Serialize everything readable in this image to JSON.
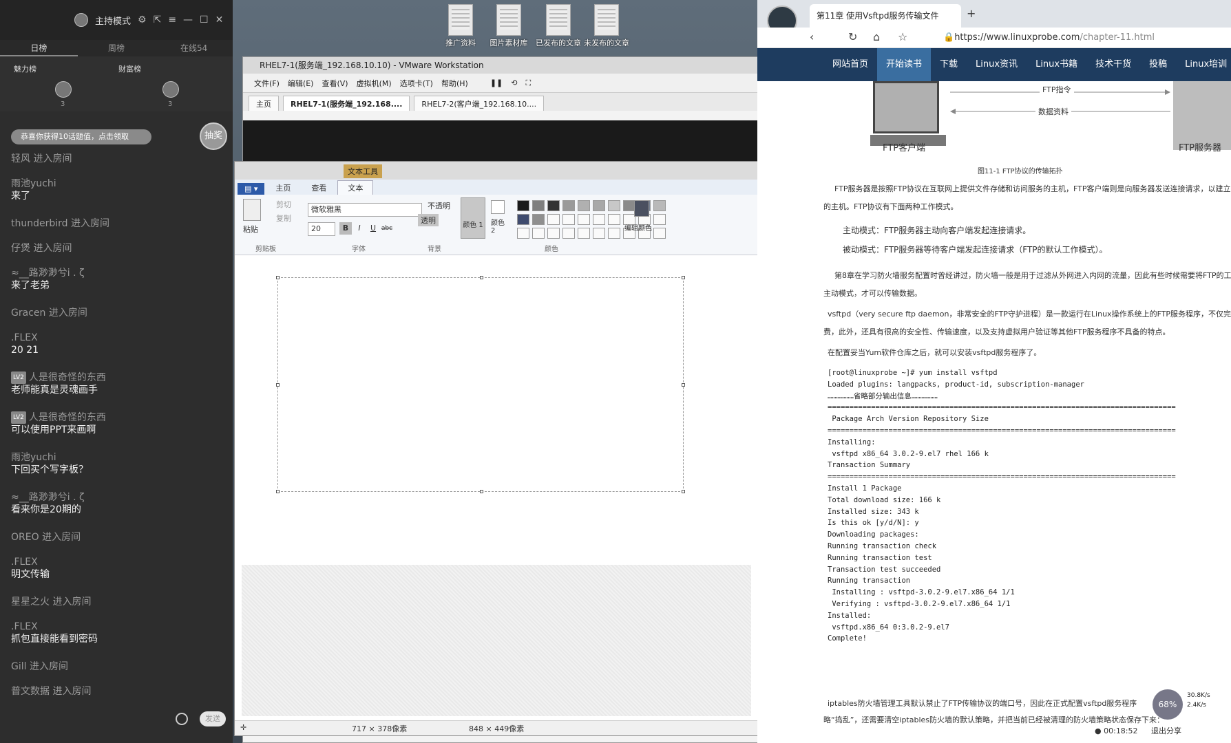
{
  "desktop": {
    "icons": [
      "推广资料",
      "图片素材库",
      "已发布的文章",
      "未发布的文章"
    ]
  },
  "chat": {
    "top_mode": "主持模式",
    "tabs": [
      "日榜",
      "周榜",
      "在线54"
    ],
    "rank_labels": [
      "魅力榜",
      "财富榜"
    ],
    "rank_counts": [
      "3",
      "3"
    ],
    "gift_banner": "恭喜你获得10话题值，点击领取",
    "host_badge": "抽奖",
    "messages": [
      {
        "user": "轻风",
        "text": "进入房间",
        "type": "enter"
      },
      {
        "user": "雨池yuchi",
        "text": "来了",
        "type": "msg"
      },
      {
        "user": "thunderbird",
        "text": "进入房间",
        "type": "enter"
      },
      {
        "user": "仔煲",
        "text": "进入房间",
        "type": "enter"
      },
      {
        "user": "≈__路渺渺兮i . ζ",
        "text": "来了老弟",
        "type": "msg"
      },
      {
        "user": "Gracen",
        "text": "进入房间",
        "type": "enter"
      },
      {
        "user": ".FLEX",
        "text": "20 21",
        "type": "msg"
      },
      {
        "user": "人是很奇怪的东西",
        "text": "老师能真是灵魂画手",
        "type": "msg",
        "lv": "LV2"
      },
      {
        "user": "人是很奇怪的东西",
        "text": "可以使用PPT来画啊",
        "type": "msg",
        "lv": "LV2"
      },
      {
        "user": "雨池yuchi",
        "text": "下回买个写字板？",
        "type": "msg"
      },
      {
        "user": "≈__路渺渺兮i . ζ",
        "text": "看来你是20期的",
        "type": "msg"
      },
      {
        "user": "OREO",
        "text": "进入房间",
        "type": "enter"
      },
      {
        "user": ".FLEX",
        "text": "明文传输",
        "type": "msg"
      },
      {
        "user": "星星之火",
        "text": "进入房间",
        "type": "enter"
      },
      {
        "user": ".FLEX",
        "text": "抓包直接能看到密码",
        "type": "msg"
      },
      {
        "user": "Gill",
        "text": "进入房间",
        "type": "enter"
      },
      {
        "user": "普文数据",
        "text": "进入房间",
        "type": "enter"
      }
    ],
    "send_label": "发送"
  },
  "vmware": {
    "title": "RHEL7-1(服务端_192.168.10.10) - VMware Workstation",
    "menu": [
      "文件(F)",
      "编辑(E)",
      "查看(V)",
      "虚拟机(M)",
      "选项卡(T)",
      "帮助(H)"
    ],
    "tabs": [
      "主页",
      "RHEL7-1(服务端_192.168....",
      "RHEL7-2(客户端_192.168.10...."
    ]
  },
  "paint": {
    "tool_tag": "文本工具",
    "tabs": [
      "主页",
      "查看",
      "文本"
    ],
    "paste": "粘贴",
    "cut": "剪切",
    "copy": "复制",
    "font_name": "微软雅黑",
    "font_size": "20",
    "opaque": "不透明",
    "transparent": "透明",
    "color1": "颜色 1",
    "color2": "颜色 2",
    "edit_colors": "编辑颜色",
    "group_labels": [
      "剪贴板",
      "字体",
      "背景",
      "颜色"
    ],
    "status_selection": "717 × 378像素",
    "status_size": "848 × 449像素",
    "palette": [
      "#1a1a1a",
      "#7f7f7f",
      "#333333",
      "#9a9a9a",
      "#b0b0b0",
      "#a8a8a8",
      "#c8c8c8",
      "#8a8a8a",
      "#6e7a8e",
      "#b9b9b9",
      "#3f4b6e",
      "#8f8f8f"
    ]
  },
  "browser": {
    "tab_title": "第11章 使用Vsftpd服务传输文件",
    "url_domain": "https://www.linuxprobe.com",
    "url_path": "/chapter-11.html",
    "nav": [
      "网站首页",
      "开始读书",
      "下载",
      "Linux资讯",
      "Linux书籍",
      "技术干货",
      "投稿",
      "Linux培训"
    ],
    "diagram": {
      "client_label": "FTP客户端",
      "server_label": "FTP服务器",
      "arrow1": "FTP指令",
      "arrow2": "数据资料",
      "caption": "图11-1  FTP协议的传输拓扑"
    },
    "paragraphs": [
      "FTP服务器是按照FTP协议在互联网上提供文件存储和访问服务的主机，FTP客户端则是向服务器发送连接请求，以建立",
      "的主机。FTP协议有下面两种工作模式。",
      "主动模式：FTP服务器主动向客户端发起连接请求。",
      "被动模式：FTP服务器等待客户端发起连接请求（FTP的默认工作模式）。",
      "第8章在学习防火墙服务配置时曾经讲过，防火墙一般是用于过滤从外网进入内网的流量，因此有些时候需要将FTP的工",
      "主动模式，才可以传输数据。",
      "vsftpd（very secure ftp daemon，非常安全的FTP守护进程）是一款运行在Linux操作系统上的FTP服务程序，不仅完",
      "费，此外，还具有很高的安全性、传输速度，以及支持虚拟用户验证等其他FTP服务程序不具备的特点。",
      "在配置妥当Yum软件仓库之后，就可以安装vsftpd服务程序了。"
    ],
    "code_lines": [
      "[root@linuxprobe ~]# yum install vsftpd",
      "Loaded plugins: langpacks, product-id, subscription-manager",
      "………………省略部分输出信息………………",
      "================================================================================",
      " Package Arch Version Repository Size",
      "================================================================================",
      "Installing:",
      " vsftpd x86_64 3.0.2-9.el7 rhel 166 k",
      "Transaction Summary",
      "================================================================================",
      "Install 1 Package",
      "Total download size: 166 k",
      "Installed size: 343 k",
      "Is this ok [y/d/N]: y",
      "Downloading packages:",
      "Running transaction check",
      "Running transaction test",
      "Transaction test succeeded",
      "Running transaction",
      " Installing : vsftpd-3.0.2-9.el7.x86_64 1/1",
      " Verifying : vsftpd-3.0.2-9.el7.x86_64 1/1",
      "Installed:",
      " vsftpd.x86_64 0:3.0.2-9.el7",
      "Complete!"
    ],
    "footer_paragraphs": [
      "iptables防火墙管理工具默认禁止了FTP传输协议的端口号，因此在正式配置vsftpd服务程序",
      "略“捣乱”，还需要清空iptables防火墙的默认策略，并把当前已经被清理的防火墙策略状态保存下来："
    ],
    "net_percent": "68%",
    "net_up": "30.8K/s",
    "net_down": "2.4K/s",
    "clock": "00:18:52",
    "exit_share": "退出分享"
  }
}
